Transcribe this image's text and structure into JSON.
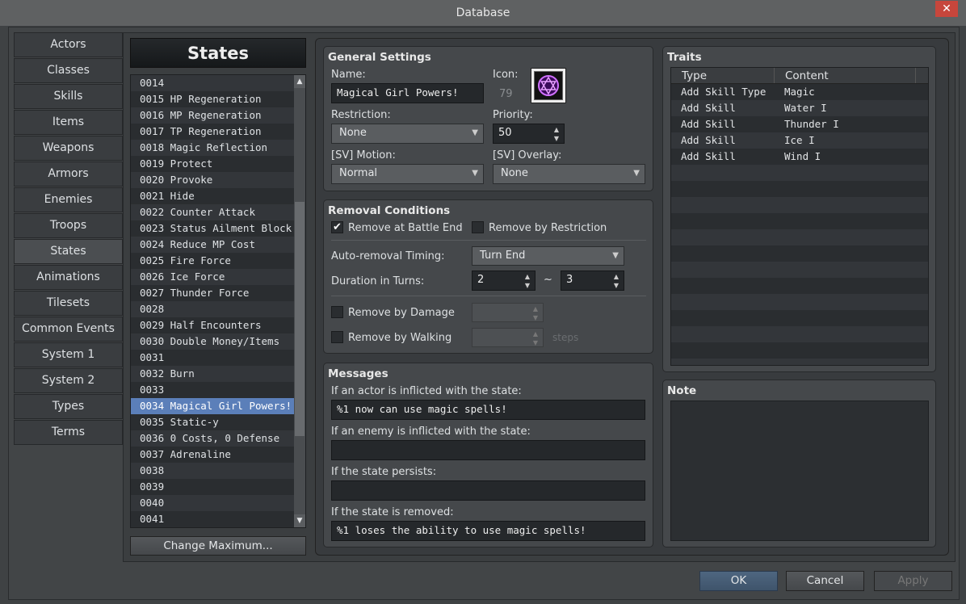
{
  "window": {
    "title": "Database",
    "close": "✕"
  },
  "nav": [
    "Actors",
    "Classes",
    "Skills",
    "Items",
    "Weapons",
    "Armors",
    "Enemies",
    "Troops",
    "States",
    "Animations",
    "Tilesets",
    "Common Events",
    "System 1",
    "System 2",
    "Types",
    "Terms"
  ],
  "nav_selected": "States",
  "list": {
    "header": "States",
    "selected": "0034 Magical Girl Powers!",
    "items": [
      "0014",
      "0015 HP Regeneration",
      "0016 MP Regeneration",
      "0017 TP Regeneration",
      "0018 Magic Reflection",
      "0019 Protect",
      "0020 Provoke",
      "0021 Hide",
      "0022 Counter Attack",
      "0023 Status Ailment Block",
      "0024 Reduce MP Cost",
      "0025 Fire Force",
      "0026 Ice Force",
      "0027 Thunder Force",
      "0028",
      "0029 Half Encounters",
      "0030 Double Money/Items",
      "0031",
      "0032 Burn",
      "0033",
      "0034 Magical Girl Powers!",
      "0035 Static-y",
      "0036 0 Costs, 0 Defense",
      "0037 Adrenaline",
      "0038",
      "0039",
      "0040",
      "0041"
    ],
    "change_max": "Change Maximum..."
  },
  "general": {
    "title": "General Settings",
    "name_label": "Name:",
    "name": "Magical Girl Powers!",
    "icon_label": "Icon:",
    "icon_index": "79",
    "restriction_label": "Restriction:",
    "restriction": "None",
    "priority_label": "Priority:",
    "priority": "50",
    "motion_label": "[SV] Motion:",
    "motion": "Normal",
    "overlay_label": "[SV] Overlay:",
    "overlay": "None"
  },
  "removal": {
    "title": "Removal Conditions",
    "battle_end": "Remove at Battle End",
    "battle_end_checked": true,
    "by_restriction": "Remove by Restriction",
    "by_restriction_checked": false,
    "timing_label": "Auto-removal Timing:",
    "timing": "Turn End",
    "duration_label": "Duration in Turns:",
    "duration_min": "2",
    "tilde": "~",
    "duration_max": "3",
    "by_damage": "Remove by Damage",
    "by_walking": "Remove by Walking",
    "steps": "steps"
  },
  "messages": {
    "title": "Messages",
    "actor_label": "If an actor is inflicted with the state:",
    "actor": "%1 now can use magic spells!",
    "enemy_label": "If an enemy is inflicted with the state:",
    "enemy": "",
    "persist_label": "If the state persists:",
    "persist": "",
    "removed_label": "If the state is removed:",
    "removed": "%1 loses the ability to use magic spells!"
  },
  "traits": {
    "title": "Traits",
    "col_type": "Type",
    "col_content": "Content",
    "rows": [
      {
        "type": "Add Skill Type",
        "content": "Magic"
      },
      {
        "type": "Add Skill",
        "content": "Water I"
      },
      {
        "type": "Add Skill",
        "content": "Thunder I"
      },
      {
        "type": "Add Skill",
        "content": "Ice I"
      },
      {
        "type": "Add Skill",
        "content": "Wind I"
      }
    ]
  },
  "note": {
    "title": "Note",
    "value": ""
  },
  "buttons": {
    "ok": "OK",
    "cancel": "Cancel",
    "apply": "Apply"
  }
}
